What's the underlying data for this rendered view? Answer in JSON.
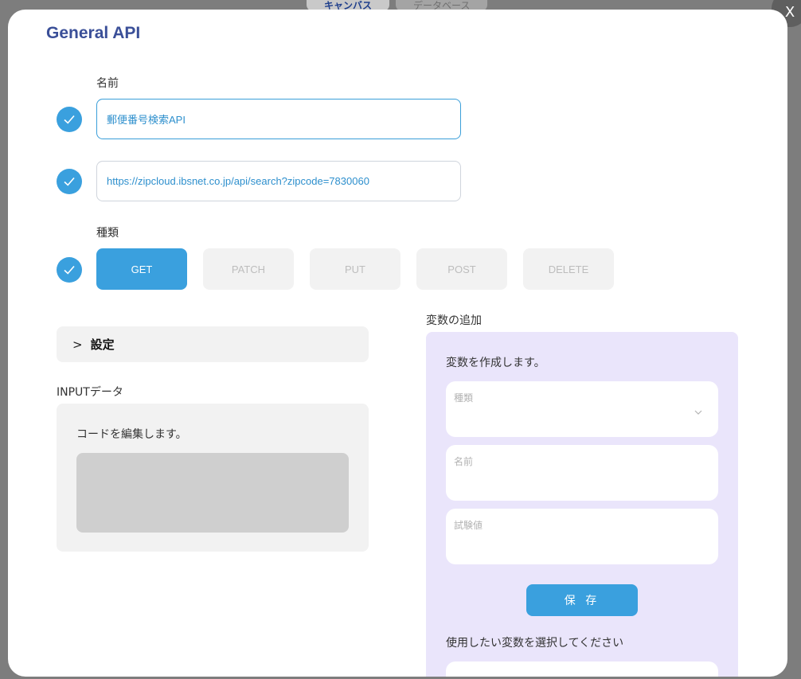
{
  "background": {
    "tabs": [
      "キャンバス",
      "データベース"
    ],
    "close_label": "X"
  },
  "modal": {
    "title": "General API",
    "name_label": "名前",
    "name_value": "郵便番号検索API",
    "url_value": "https://zipcloud.ibsnet.co.jp/api/search?zipcode=7830060",
    "method_label": "種類",
    "methods": [
      "GET",
      "PATCH",
      "PUT",
      "POST",
      "DELETE"
    ],
    "selected_method": "GET",
    "settings": {
      "chevron": ">",
      "label": "設定"
    },
    "input_data": {
      "label": "INPUTデータ",
      "description": "コードを編集します。"
    },
    "variables": {
      "label": "変数の追加",
      "description": "変数を作成します。",
      "type_placeholder": "種類",
      "name_placeholder": "名前",
      "test_value_placeholder": "試験値",
      "save_label": "保 存",
      "select_label": "使用したい変数を選択してください"
    }
  },
  "colors": {
    "accent": "#3aa0de",
    "title": "#3a4f98",
    "variable_panel": "#eae5fb"
  },
  "icons": {
    "check": "check-icon",
    "close": "close-icon",
    "chevron_right": "chevron-right-icon",
    "chevron_down": "chevron-down-icon"
  }
}
